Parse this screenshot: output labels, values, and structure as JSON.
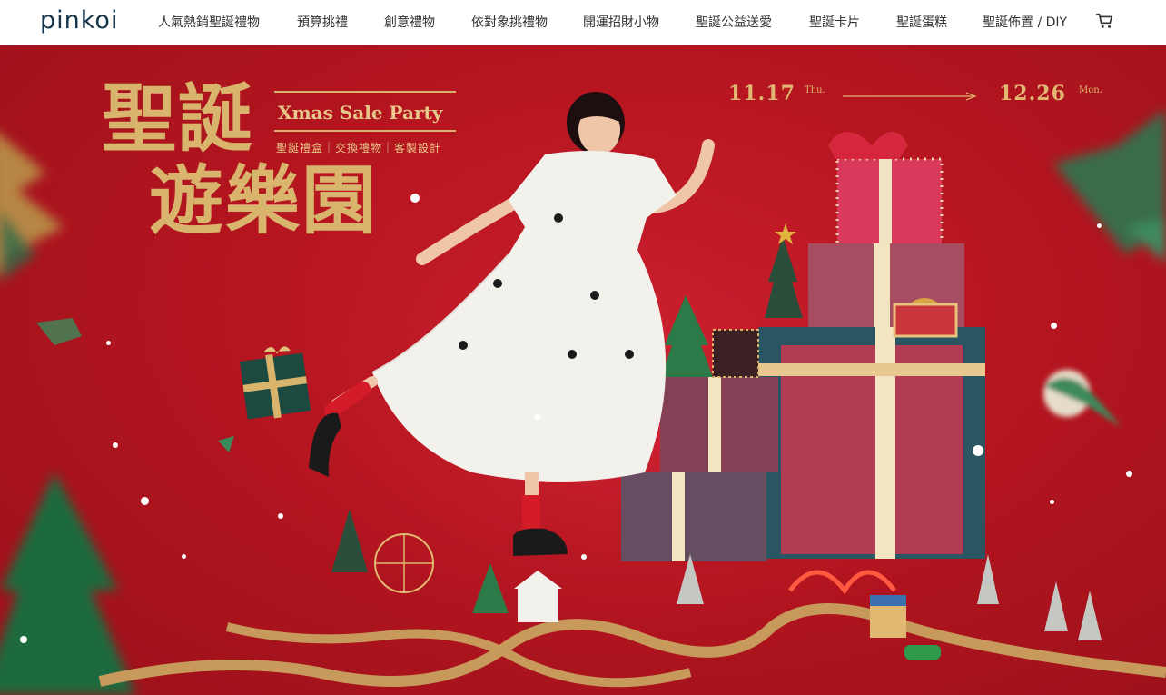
{
  "header": {
    "logo": "pinkoi",
    "nav_items": [
      "人氣熱銷聖誕禮物",
      "預算挑禮",
      "創意禮物",
      "依對象挑禮物",
      "開運招財小物",
      "聖誕公益送愛",
      "聖誕卡片",
      "聖誕蛋糕",
      "聖誕佈置 / DIY"
    ],
    "cart_icon": "shopping-cart-icon"
  },
  "hero": {
    "title_line1": "聖誕",
    "title_line2": "遊樂園",
    "subtitle_en": "Xmas Sale Party",
    "tags": "聖誕禮盒｜交換禮物｜客製設計",
    "start_date": "11.17",
    "start_day": "Thu.",
    "end_date": "12.26",
    "end_day": "Mon.",
    "colors": {
      "background": "#b4151f",
      "gold": "#d9b46c",
      "dress": "#f3f1ec",
      "gift_teal": "#2e5a66",
      "gift_pink": "#d93a5b",
      "tree_green": "#1e5a3a"
    }
  }
}
